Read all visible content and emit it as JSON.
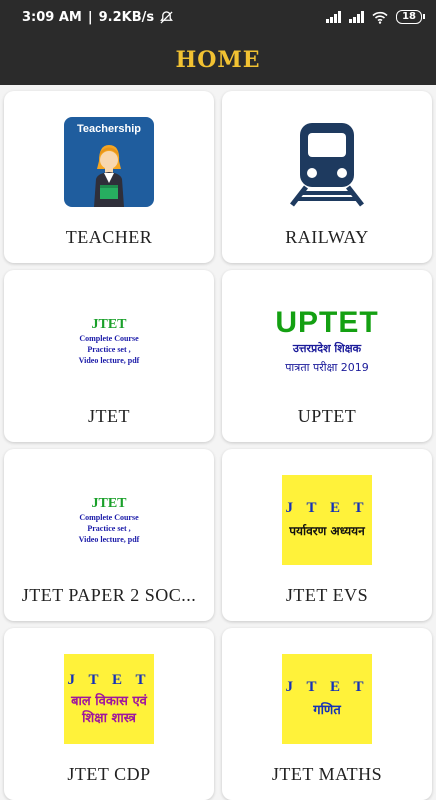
{
  "status": {
    "time": "3:09 AM",
    "speed": "9.2KB/s",
    "battery": "18"
  },
  "appbar": {
    "title": "HOME"
  },
  "cards": [
    {
      "label": "TEACHER",
      "thumb": {
        "title": "Teachership"
      }
    },
    {
      "label": "RAILWAY"
    },
    {
      "label": "JTET",
      "thumb": {
        "big": "JTET",
        "l1": "Complete Course",
        "l2": "Practice set ,",
        "l3": "Video lecture, pdf"
      }
    },
    {
      "label": "UPTET",
      "thumb": {
        "big": "UPTET",
        "l1": "उत्तरप्रदेश शिक्षक",
        "l2": "पात्रता परीक्षा 2019"
      }
    },
    {
      "label": "JTET PAPER 2 SOC...",
      "thumb": {
        "big": "JTET",
        "l1": "Complete Course",
        "l2": "Practice set ,",
        "l3": "Video lecture, pdf"
      }
    },
    {
      "label": "JTET EVS",
      "thumb": {
        "big": "J T E T",
        "l1": "पर्यावरण अध्ययन"
      }
    },
    {
      "label": "JTET CDP",
      "thumb": {
        "big": "J T E T",
        "l1": "बाल विकास एवं",
        "l2": "शिक्षा शास्त्र"
      }
    },
    {
      "label": "JTET MATHS",
      "thumb": {
        "big": "J T E T",
        "l1": "गणित"
      }
    }
  ],
  "colors": {
    "appbar": "#2b2b2b",
    "title": "#f2c232",
    "railway_icon": "#1e3a5f",
    "thumb_yellow": "#fff23a",
    "cdp_text": "#a0169e",
    "maths_text": "#1531b7"
  },
  "icons": {
    "wifi": "wifi-icon",
    "signal": "signal-icon",
    "battery": "battery-icon",
    "mute": "notification-off-icon",
    "train": "train-icon"
  }
}
